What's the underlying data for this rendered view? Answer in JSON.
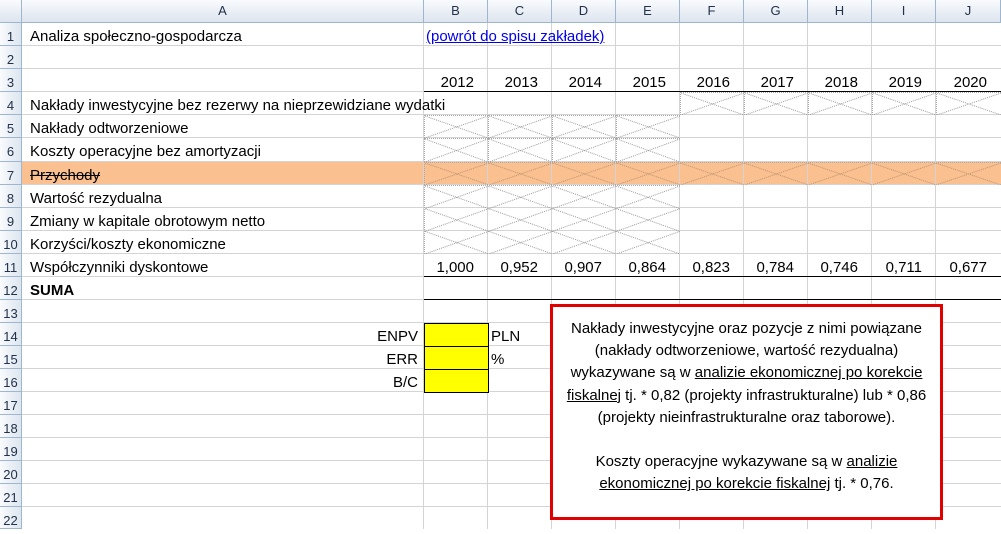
{
  "columns": [
    "A",
    "B",
    "C",
    "D",
    "E",
    "F",
    "G",
    "H",
    "I",
    "J"
  ],
  "rows": [
    "1",
    "2",
    "3",
    "4",
    "5",
    "6",
    "7",
    "8",
    "9",
    "10",
    "11",
    "12",
    "13",
    "14",
    "15",
    "16",
    "17",
    "18",
    "19",
    "20",
    "21",
    "22"
  ],
  "title": "Analiza społeczno-gospodarcza",
  "link": "(powrót do spisu zakładek)",
  "years": [
    "2012",
    "2013",
    "2014",
    "2015",
    "2016",
    "2017",
    "2018",
    "2019",
    "2020"
  ],
  "labels": {
    "r4": "Nakłady inwestycyjne bez rezerwy na nieprzewidziane wydatki",
    "r5": "Nakłady odtworzeniowe",
    "r6": "Koszty operacyjne bez amortyzacji",
    "r7": "Przychody",
    "r8": "Wartość rezydualna",
    "r9": "Zmiany w kapitale obrotowym netto",
    "r10": "Korzyści/koszty ekonomiczne",
    "r11": "Współczynniki dyskontowe",
    "r12": "SUMA"
  },
  "discount_factors": [
    "1,000",
    "0,952",
    "0,907",
    "0,864",
    "0,823",
    "0,784",
    "0,746",
    "0,711",
    "0,677"
  ],
  "metrics": [
    {
      "label": "ENPV",
      "unit": "PLN"
    },
    {
      "label": "ERR",
      "unit": "%"
    },
    {
      "label": "B/C",
      "unit": ""
    }
  ],
  "note": {
    "p1a": "Nakłady inwestycyjne oraz pozycje z nimi powiązane (nakłady odtworzeniowe, wartość rezydualna) wykazywane są w ",
    "p1u": "analizie ekonomicznej  po korekcie fiskalnej",
    "p1b": " tj.  * 0,82 (projekty infrastrukturalne) lub  * 0,86 (projekty nieinfrastrukturalne oraz taborowe).",
    "p2a": "Koszty operacyjne wykazywane są w ",
    "p2u": "analizie ekonomicznej  po korekcie fiskalnej",
    "p2b": " tj.  * 0,76."
  },
  "colors": {
    "highlight_row": "#fac090",
    "input_cell": "#ffff00",
    "note_border": "#e00000"
  }
}
